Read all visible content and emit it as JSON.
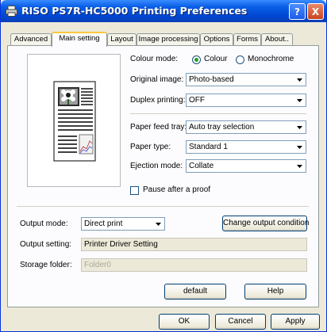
{
  "window": {
    "title": "RISO PS7R-HC5000 Printing Preferences",
    "help_glyph": "?",
    "close_glyph": "X"
  },
  "tabs": [
    {
      "label": "Advanced",
      "active": false
    },
    {
      "label": "Main setting",
      "active": true
    },
    {
      "label": "Layout",
      "active": false
    },
    {
      "label": "Image processing",
      "active": false
    },
    {
      "label": "Options",
      "active": false
    },
    {
      "label": "Forms",
      "active": false
    },
    {
      "label": "About..",
      "active": false
    }
  ],
  "main": {
    "colour_mode": {
      "label": "Colour mode:",
      "options": [
        "Colour",
        "Monochrome"
      ],
      "selected": "Colour"
    },
    "original_image": {
      "label": "Original image:",
      "value": "Photo-based"
    },
    "duplex_printing": {
      "label": "Duplex printing:",
      "value": "OFF"
    },
    "paper_feed_tray": {
      "label": "Paper feed tray:",
      "value": "Auto tray selection"
    },
    "paper_type": {
      "label": "Paper type:",
      "value": "Standard 1"
    },
    "ejection_mode": {
      "label": "Ejection mode:",
      "value": "Collate"
    },
    "pause_after_proof": {
      "label": "Pause after a proof",
      "checked": false
    },
    "output_mode": {
      "label": "Output mode:",
      "value": "Direct print"
    },
    "change_output_button": "Change output condition",
    "output_setting": {
      "label": "Output setting:",
      "value": "Printer Driver Setting"
    },
    "storage_folder": {
      "label": "Storage folder:",
      "value": "Folder0"
    },
    "default_button": "default",
    "help_button": "Help"
  },
  "footer": {
    "ok": "OK",
    "cancel": "Cancel",
    "apply": "Apply"
  },
  "colors": {
    "titlebar": "#0047d4",
    "window_bg": "#ece9d8",
    "panel_bg": "#fcfcfe",
    "active_tab_accent": "#ffc73c",
    "radio_dot": "#21a121"
  }
}
